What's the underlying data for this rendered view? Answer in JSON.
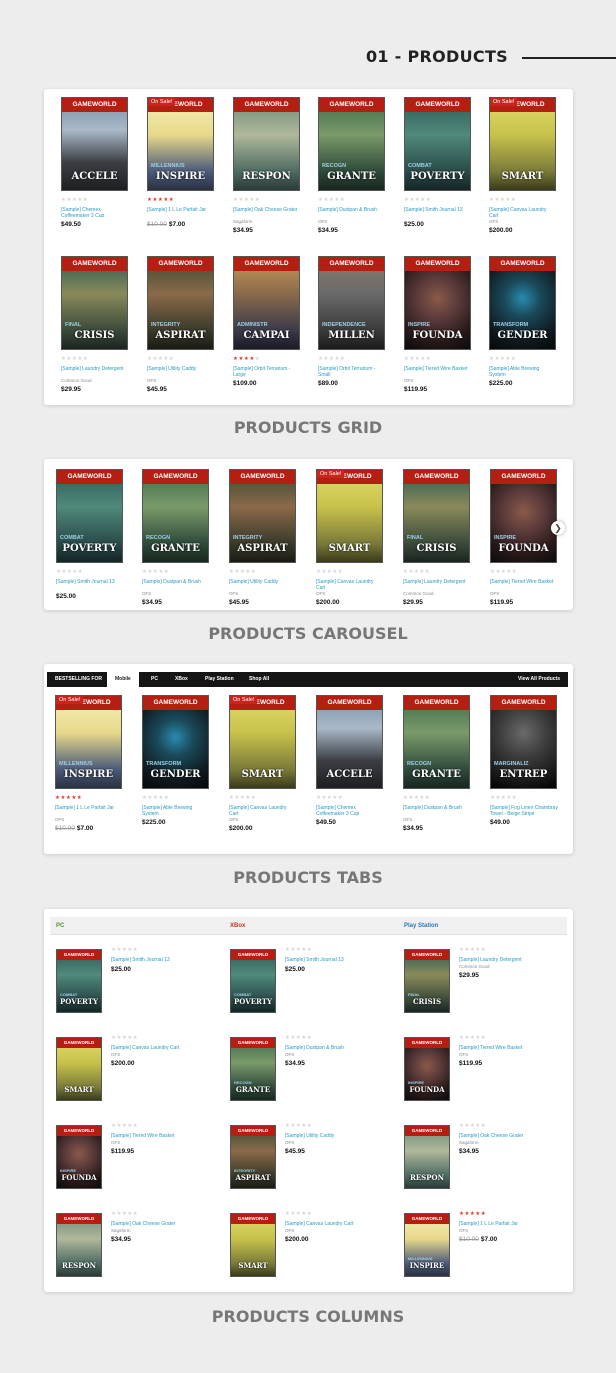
{
  "header": {
    "title": "01 - PRODUCTS"
  },
  "brand": "GAMEWORLD",
  "sale_label": "On Sale!",
  "covers": {
    "accele": {
      "title": "ACCELE",
      "sub": "",
      "bg": "linear-gradient(180deg,#7a8fa8 0%,#a9b9c8 35%,#3b3f44 70%,#1d1f22 100%)"
    },
    "inspire": {
      "title": "INSPIRE",
      "sub": "MILLENNIUS",
      "bg": "linear-gradient(180deg,#f5f0b8 0%,#e8d98a 40%,#4a5a7a 80%,#2a3040 100%)"
    },
    "respon": {
      "title": "RESPON",
      "sub": "",
      "bg": "linear-gradient(180deg,#6b8a78 0%,#b0b89a 40%,#4d6b62 80%,#2a3a38 100%)"
    },
    "grante": {
      "title": "GRANTE",
      "sub": "RECOGN",
      "bg": "linear-gradient(180deg,#3d6b4a 0%,#7a9a6a 40%,#2e4a3a 80%,#18261e 100%)"
    },
    "poverty": {
      "title": "POVERTY",
      "sub": "COMBAT",
      "bg": "linear-gradient(180deg,#2e5a5a 0%,#4f8a7a 40%,#2a4a4a 80%,#142424 100%)"
    },
    "smart": {
      "title": "SMART",
      "sub": "",
      "bg": "linear-gradient(180deg,#e0dc6a 0%,#c8c24a 40%,#7a7a3a 80%,#3a3a1a 100%)"
    },
    "crisis": {
      "title": "CRISIS",
      "sub": "FINAL",
      "bg": "linear-gradient(180deg,#2a5a52 0%,#8a8a5a 40%,#3a4a3a 80%,#1a2420 100%)"
    },
    "aspirat": {
      "title": "ASPIRAT",
      "sub": "INTEGRITY",
      "bg": "linear-gradient(180deg,#3a4a30 0%,#8a6a4a 40%,#3a3a2a 80%,#1a1a14 100%)"
    },
    "campai": {
      "title": "CAMPAI",
      "sub": "ADMINISTR",
      "bg": "linear-gradient(180deg,#c89a5a 0%,#8a6a4a 40%,#3a3a4a 80%,#1a1a24 100%)"
    },
    "millen": {
      "title": "MILLEN",
      "sub": "INDEPENDENCE",
      "bg": "linear-gradient(180deg,#8a7a6a 0%,#6a6a6a 40%,#3a3a3a 80%,#1a1a1a 100%)"
    },
    "founda": {
      "title": "FOUNDA",
      "sub": "INSPIRE",
      "bg": "radial-gradient(circle at 50% 45%,#8a5a4a 0%,#5a3a3a 35%,#2a1a1a 70%,#0a0a0a 100%)"
    },
    "gender": {
      "title": "GENDER",
      "sub": "TRANSFORM",
      "bg": "radial-gradient(circle at 50% 45%,#2a8ab0 0%,#1a4a5a 30%,#101a20 70%,#050808 100%)"
    },
    "entrep": {
      "title": "ENTREP",
      "sub": "MARGINALIZ",
      "bg": "radial-gradient(circle at 50% 40%,#6a6a6a 0%,#3a3a3a 40%,#151515 80%,#000 100%)"
    }
  },
  "grid": {
    "caption": "PRODUCTS GRID",
    "items": [
      {
        "cover": "accele",
        "name": "[Sample] Chemex Coffeemaker 3 Cup",
        "vendor": "",
        "price": "$49.50",
        "old": "",
        "stars": 0,
        "sale": false
      },
      {
        "cover": "inspire",
        "name": "[Sample] 1 L Le Parfait Jar",
        "vendor": "",
        "price": "$7.00",
        "old": "$10.00",
        "stars": 5,
        "sale": true
      },
      {
        "cover": "respon",
        "name": "[Sample] Oak Cheese Grater",
        "vendor": "Sagaform",
        "price": "$34.95",
        "old": "",
        "stars": 0,
        "sale": false
      },
      {
        "cover": "grante",
        "name": "[Sample] Dustpan & Brush",
        "vendor": "OFS",
        "price": "$34.95",
        "old": "",
        "stars": 0,
        "sale": false
      },
      {
        "cover": "poverty",
        "name": "[Sample] Smith Journal 13",
        "vendor": "",
        "price": "$25.00",
        "old": "",
        "stars": 0,
        "sale": false
      },
      {
        "cover": "smart",
        "name": "[Sample] Canvas Laundry Cart",
        "vendor": "OFS",
        "price": "$200.00",
        "old": "",
        "stars": 0,
        "sale": true
      },
      {
        "cover": "crisis",
        "name": "[Sample] Laundry Detergent",
        "vendor": "Common Good",
        "price": "$29.95",
        "old": "",
        "stars": 0,
        "sale": false
      },
      {
        "cover": "aspirat",
        "name": "[Sample] Utility Caddy",
        "vendor": "OFS",
        "price": "$45.95",
        "old": "",
        "stars": 0,
        "sale": false
      },
      {
        "cover": "campai",
        "name": "[Sample] Orbit Terrarium - Large",
        "vendor": "",
        "price": "$109.00",
        "old": "",
        "stars": 4,
        "sale": false
      },
      {
        "cover": "millen",
        "name": "[Sample] Orbit Terrarium - Small",
        "vendor": "",
        "price": "$89.00",
        "old": "",
        "stars": 0,
        "sale": false
      },
      {
        "cover": "founda",
        "name": "[Sample] Tiered Wire Basket",
        "vendor": "OFS",
        "price": "$119.95",
        "old": "",
        "stars": 0,
        "sale": false
      },
      {
        "cover": "gender",
        "name": "[Sample] Able Brewing System",
        "vendor": "",
        "price": "$225.00",
        "old": "",
        "stars": 0,
        "sale": false
      }
    ]
  },
  "carousel": {
    "caption": "PRODUCTS CAROUSEL",
    "next_icon": "chevron-right-icon",
    "items": [
      {
        "cover": "poverty",
        "name": "[Sample] Smith Journal 13",
        "vendor": "",
        "price": "$25.00",
        "old": "",
        "stars": 0,
        "sale": false
      },
      {
        "cover": "grante",
        "name": "[Sample] Dustpan & Brush",
        "vendor": "OFS",
        "price": "$34.95",
        "old": "",
        "stars": 0,
        "sale": false
      },
      {
        "cover": "aspirat",
        "name": "[Sample] Utility Caddy",
        "vendor": "OFS",
        "price": "$45.95",
        "old": "",
        "stars": 0,
        "sale": false
      },
      {
        "cover": "smart",
        "name": "[Sample] Canvas Laundry Cart",
        "vendor": "OFS",
        "price": "$200.00",
        "old": "",
        "stars": 0,
        "sale": true
      },
      {
        "cover": "crisis",
        "name": "[Sample] Laundry Detergent",
        "vendor": "Common Good",
        "price": "$29.95",
        "old": "",
        "stars": 0,
        "sale": false
      },
      {
        "cover": "founda",
        "name": "[Sample] Tiered Wire Basket",
        "vendor": "OFS",
        "price": "$119.95",
        "old": "",
        "stars": 0,
        "sale": false
      }
    ]
  },
  "tabs": {
    "caption": "PRODUCTS TABS",
    "bestselling": "BESTSELLING FOR",
    "labels": [
      "Mobile",
      "PC",
      "XBox",
      "Play Station",
      "Shop All"
    ],
    "active": 0,
    "view_all": "View All Products",
    "items": [
      {
        "cover": "inspire",
        "name": "[Sample] 1 L Le Parfait Jar",
        "vendor": "OFS",
        "price": "$7.00",
        "old": "$10.00",
        "stars": 5,
        "sale": true
      },
      {
        "cover": "gender",
        "name": "[Sample] Able Brewing System",
        "vendor": "",
        "price": "$225.00",
        "old": "",
        "stars": 0,
        "sale": false
      },
      {
        "cover": "smart",
        "name": "[Sample] Canvas Laundry Cart",
        "vendor": "OFS",
        "price": "$200.00",
        "old": "",
        "stars": 0,
        "sale": true
      },
      {
        "cover": "accele",
        "name": "[Sample] Chemex Coffeemaker 3 Cup",
        "vendor": "",
        "price": "$49.50",
        "old": "",
        "stars": 0,
        "sale": false
      },
      {
        "cover": "grante",
        "name": "[Sample] Dustpan & Brush",
        "vendor": "OFS",
        "price": "$34.95",
        "old": "",
        "stars": 0,
        "sale": false
      },
      {
        "cover": "entrep",
        "name": "[Sample] Fog Linen Chambray Towel - Beige Stripe",
        "vendor": "",
        "price": "$49.00",
        "old": "",
        "stars": 0,
        "sale": false
      }
    ]
  },
  "columns": {
    "caption": "PRODUCTS COLUMNS",
    "headers": [
      {
        "label": "PC",
        "color": "#4a9a2a"
      },
      {
        "label": "XBox",
        "color": "#c0392b"
      },
      {
        "label": "Play Station",
        "color": "#2a7ab0"
      }
    ],
    "cols": [
      [
        {
          "cover": "poverty",
          "name": "[Sample] Smith Journal 13",
          "vendor": "",
          "price": "$25.00",
          "old": "",
          "stars": 0
        },
        {
          "cover": "smart",
          "name": "[Sample] Canvas Laundry Cart",
          "vendor": "OFS",
          "price": "$200.00",
          "old": "",
          "stars": 0
        },
        {
          "cover": "founda",
          "name": "[Sample] Tiered Wire Basket",
          "vendor": "OFS",
          "price": "$119.95",
          "old": "",
          "stars": 0
        },
        {
          "cover": "respon",
          "name": "[Sample] Oak Cheese Grater",
          "vendor": "Sagaform",
          "price": "$34.95",
          "old": "",
          "stars": 0
        }
      ],
      [
        {
          "cover": "poverty",
          "name": "[Sample] Smith Journal 13",
          "vendor": "",
          "price": "$25.00",
          "old": "",
          "stars": 0
        },
        {
          "cover": "grante",
          "name": "[Sample] Dustpan & Brush",
          "vendor": "OFS",
          "price": "$34.95",
          "old": "",
          "stars": 0
        },
        {
          "cover": "aspirat",
          "name": "[Sample] Utility Caddy",
          "vendor": "OFS",
          "price": "$45.95",
          "old": "",
          "stars": 0
        },
        {
          "cover": "smart",
          "name": "[Sample] Canvas Laundry Cart",
          "vendor": "OFS",
          "price": "$200.00",
          "old": "",
          "stars": 0
        }
      ],
      [
        {
          "cover": "crisis",
          "name": "[Sample] Laundry Detergent",
          "vendor": "Common Good",
          "price": "$29.95",
          "old": "",
          "stars": 0
        },
        {
          "cover": "founda",
          "name": "[Sample] Tiered Wire Basket",
          "vendor": "OFS",
          "price": "$119.95",
          "old": "",
          "stars": 0
        },
        {
          "cover": "respon",
          "name": "[Sample] Oak Cheese Grater",
          "vendor": "Sagaform",
          "price": "$34.95",
          "old": "",
          "stars": 0
        },
        {
          "cover": "inspire",
          "name": "[Sample] 1 L Le Parfait Jar",
          "vendor": "OFS",
          "price": "$7.00",
          "old": "$10.00",
          "stars": 5
        }
      ]
    ]
  }
}
